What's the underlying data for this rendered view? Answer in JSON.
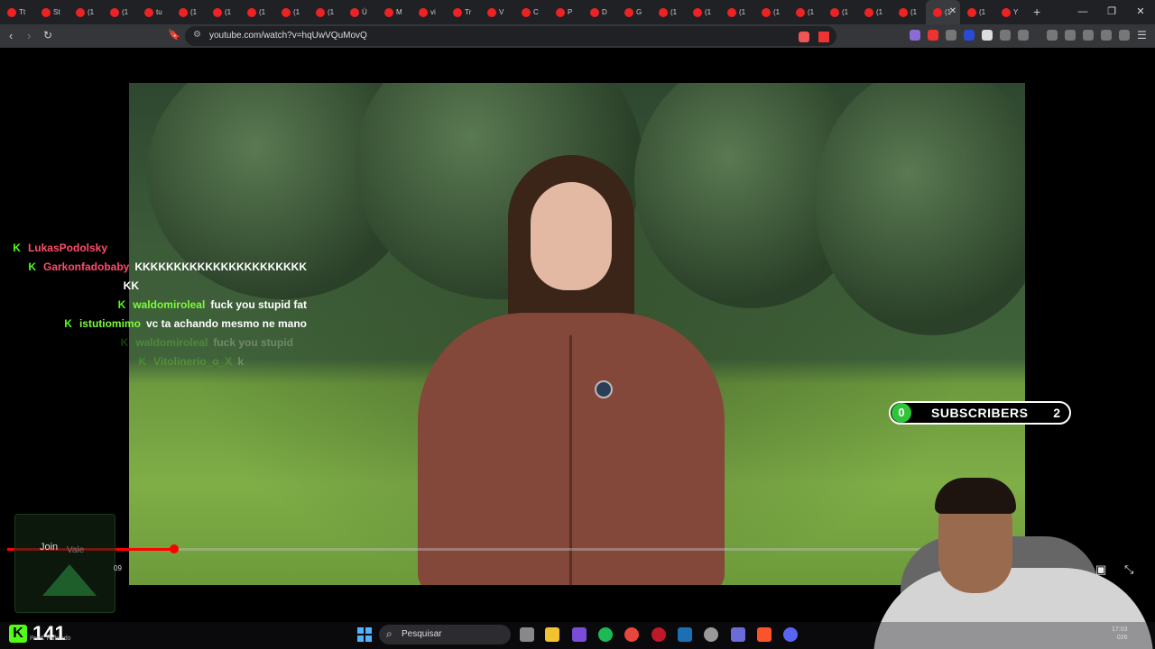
{
  "browser": {
    "tab_labels": [
      "Tt",
      "St",
      "(1",
      "(1",
      "tu",
      "(1",
      "(1",
      "(1",
      "(1",
      "(1",
      "Ú",
      "M",
      "vi",
      "Tr",
      "V",
      "C",
      "P",
      "D",
      "G",
      "(1",
      "(1",
      "(1",
      "(1",
      "(1",
      "(1",
      "(1",
      "(1",
      "(1",
      "(1",
      "Y"
    ],
    "url": "youtube.com/watch?v=hqUwVQuMovQ",
    "new_tab": "+",
    "close": "✕"
  },
  "chat": [
    {
      "user": "LukasPodolsky",
      "color": "#ff4d6a",
      "text": ""
    },
    {
      "user": "Garkonfadobaby",
      "color": "#ff4d6a",
      "text": "KKKKKKKKKKKKKKKKKKKKKK"
    },
    {
      "user": "",
      "color": "#ffffff",
      "text": "KK"
    },
    {
      "user": "waldomiroleal",
      "color": "#7cfc3a",
      "text": "fuck you stupid fat"
    },
    {
      "user": "istutiomimo",
      "color": "#7cfc3a",
      "text": "vc ta achando mesmo ne mano"
    },
    {
      "user": "waldomiroleal",
      "color": "#7cfc3a",
      "text": "fuck you stupid"
    },
    {
      "user": "Vitolinerio_o_X",
      "color": "#7cfc3a",
      "text": "k"
    }
  ],
  "subscribers": {
    "label": "SUBSCRIBERS",
    "left": "0",
    "right": "2"
  },
  "overlay": {
    "join": "Join",
    "vale": "Vale",
    "timestamp": "09"
  },
  "viewer_count": "141",
  "pred_sub": "Pred. Rubrado",
  "taskbar": {
    "search_placeholder": "Pesquisar",
    "time": "17:03",
    "date": "026"
  },
  "colors": {
    "kick_green": "#53fc18",
    "yt_red": "#ff0000"
  },
  "video_progress_fraction": 0.18
}
